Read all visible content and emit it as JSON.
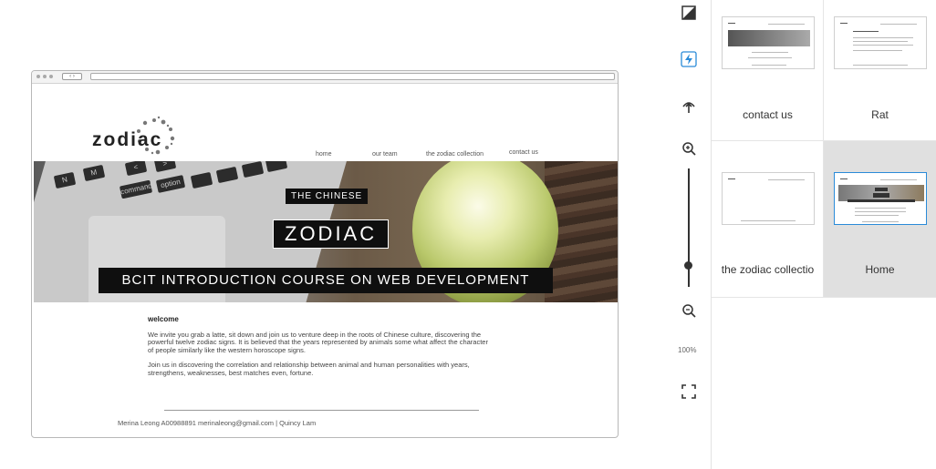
{
  "preview": {
    "logo_text": "zodiac",
    "nav": [
      "home",
      "our team",
      "the zodiac collection",
      "contact us"
    ],
    "hero": {
      "line1": "THE CHINESE",
      "line2": "ZODIAC",
      "line3": "BCIT INTRODUCTION COURSE ON WEB DEVELOPMENT"
    },
    "welcome_heading": "welcome",
    "paragraph1": "We invite you grab a latte, sit down and join us to venture deep in the roots of Chinese culture, discovering the powerful twelve zodiac signs. It is believed that the years represented by animals some what affect the character of people similarly like the western horoscope signs.",
    "paragraph2": "Join us in discovering the correlation and relationship between animal and human personalities with years, strengthens, weaknesses, best matches even, fortune.",
    "footer": "Merina Leong   A00988891   merinaleong@gmail.com    |   Quincy Lam",
    "keys": [
      "N",
      "M",
      "<",
      ">",
      "?",
      "⌘",
      "command",
      "option"
    ]
  },
  "tools": {
    "zoom_level": "100%"
  },
  "pages": [
    {
      "label": "contact us",
      "selected": false
    },
    {
      "label": "Rat",
      "selected": false
    },
    {
      "label": "the zodiac collectio",
      "selected": false
    },
    {
      "label": "Home",
      "selected": true
    }
  ]
}
